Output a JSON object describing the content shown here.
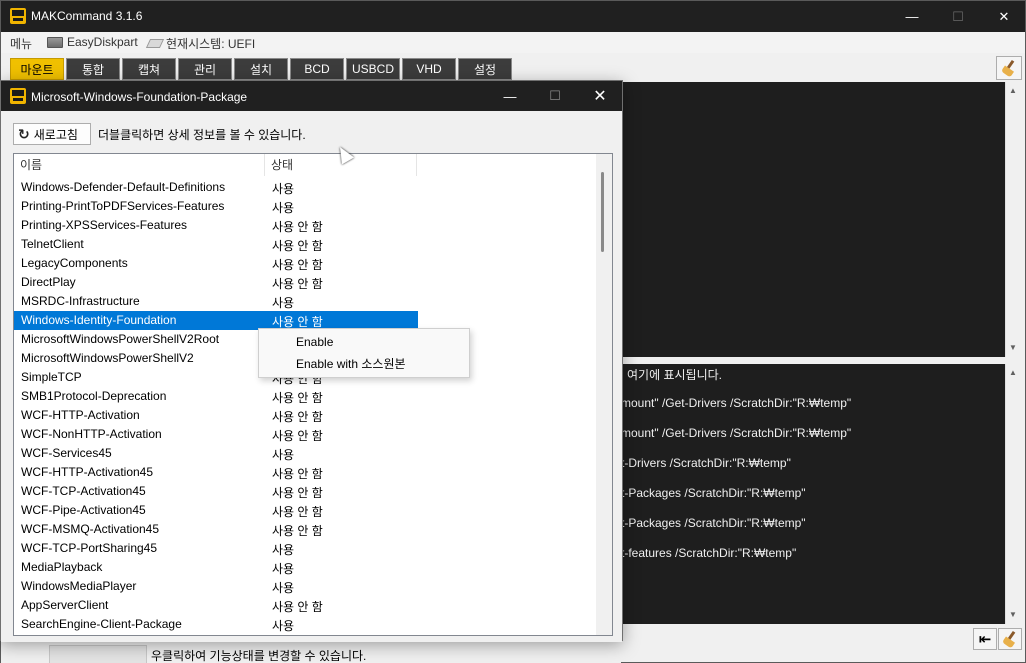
{
  "main_window": {
    "title": "MAKCommand 3.1.6",
    "controls": {
      "minimize": "—",
      "maximize": "☐",
      "close": "✕"
    }
  },
  "menubar": {
    "main": "메뉴",
    "diskpart": "EasyDiskpart",
    "sysinfo": "현재시스템: UEFI"
  },
  "tabs": [
    "마운트",
    "통합",
    "캡쳐",
    "관리",
    "설치",
    "BCD",
    "USBCD",
    "VHD",
    "설정"
  ],
  "active_tab": "마운트",
  "log_console": {
    "lines": [
      "l 여기에 표시됩니다.",
      "mount\" /Get-Drivers /ScratchDir:\"R:₩temp\"",
      "mount\" /Get-Drivers /ScratchDir:\"R:₩temp\"",
      "t-Drivers /ScratchDir:\"R:₩temp\"",
      "t-Packages /ScratchDir:\"R:₩temp\"",
      "t-Packages /ScratchDir:\"R:₩temp\"",
      "t-features /ScratchDir:\"R:₩temp\""
    ]
  },
  "statusbar": {
    "text": "우클릭하여 기능상태를 변경할 수 있습니다."
  },
  "dialog": {
    "title": "Microsoft-Windows-Foundation-Package",
    "controls": {
      "minimize": "—",
      "maximize": "☐",
      "close": "✕"
    },
    "refresh_label": "새로고침",
    "hint": "더블클릭하면 상세 정보를 볼 수 있습니다.",
    "columns": {
      "name": "이름",
      "status": "상태"
    },
    "rows": [
      {
        "name": "Windows-Defender-Default-Definitions",
        "status": "사용"
      },
      {
        "name": "Printing-PrintToPDFServices-Features",
        "status": "사용"
      },
      {
        "name": "Printing-XPSServices-Features",
        "status": "사용 안 함"
      },
      {
        "name": "TelnetClient",
        "status": "사용 안 함"
      },
      {
        "name": "LegacyComponents",
        "status": "사용 안 함"
      },
      {
        "name": "DirectPlay",
        "status": "사용 안 함"
      },
      {
        "name": "MSRDC-Infrastructure",
        "status": "사용"
      },
      {
        "name": "Windows-Identity-Foundation",
        "status": "사용 안 함"
      },
      {
        "name": "MicrosoftWindowsPowerShellV2Root",
        "status": ""
      },
      {
        "name": "MicrosoftWindowsPowerShellV2",
        "status": ""
      },
      {
        "name": "SimpleTCP",
        "status": "사용 안 함"
      },
      {
        "name": "SMB1Protocol-Deprecation",
        "status": "사용 안 함"
      },
      {
        "name": "WCF-HTTP-Activation",
        "status": "사용 안 함"
      },
      {
        "name": "WCF-NonHTTP-Activation",
        "status": "사용 안 함"
      },
      {
        "name": "WCF-Services45",
        "status": "사용"
      },
      {
        "name": "WCF-HTTP-Activation45",
        "status": "사용 안 함"
      },
      {
        "name": "WCF-TCP-Activation45",
        "status": "사용 안 함"
      },
      {
        "name": "WCF-Pipe-Activation45",
        "status": "사용 안 함"
      },
      {
        "name": "WCF-MSMQ-Activation45",
        "status": "사용 안 함"
      },
      {
        "name": "WCF-TCP-PortSharing45",
        "status": "사용"
      },
      {
        "name": "MediaPlayback",
        "status": "사용"
      },
      {
        "name": "WindowsMediaPlayer",
        "status": "사용"
      },
      {
        "name": "AppServerClient",
        "status": "사용 안 함"
      },
      {
        "name": "SearchEngine-Client-Package",
        "status": "사용"
      }
    ],
    "selected_row": "Windows-Identity-Foundation"
  },
  "context_menu": {
    "items": [
      "Enable",
      "Enable with 소스원본"
    ]
  },
  "icons": {
    "app": "makcommand-logo-icon",
    "refresh": "refresh-icon",
    "clean": "broom-icon",
    "back": "enter-arrow-icon"
  }
}
